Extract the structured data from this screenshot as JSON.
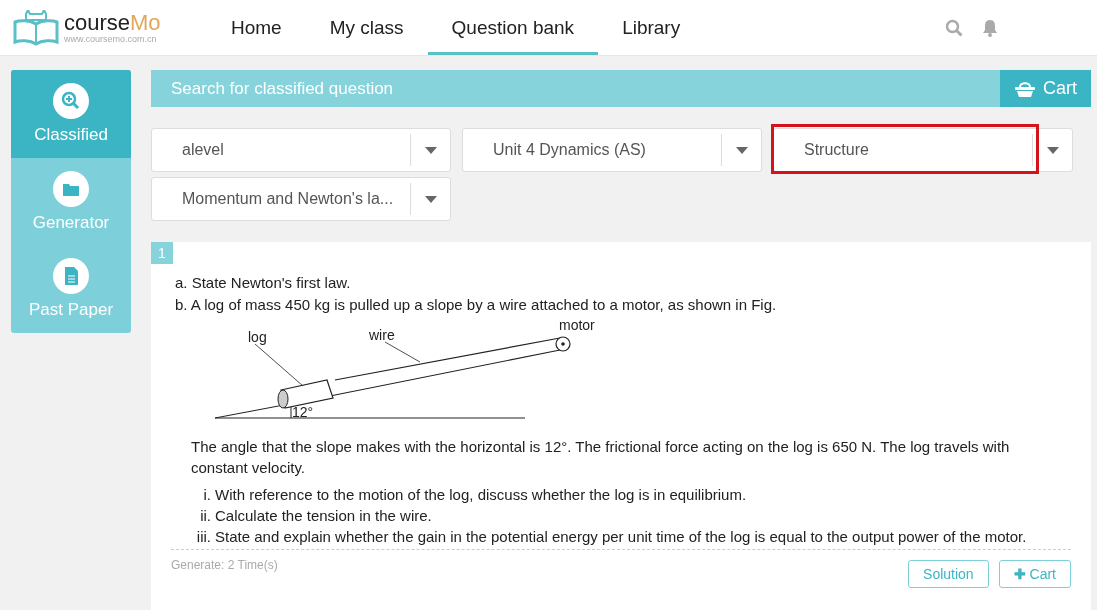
{
  "logo": {
    "name": "course",
    "name_accent": "Mo",
    "url": "www.coursemo.com.cn"
  },
  "nav": [
    {
      "label": "Home",
      "selected": false
    },
    {
      "label": "My class",
      "selected": false
    },
    {
      "label": "Question bank",
      "selected": true
    },
    {
      "label": "Library",
      "selected": false
    }
  ],
  "sidebar": {
    "items": [
      {
        "label": "Classified",
        "selected": true,
        "kind": "search"
      },
      {
        "label": "Generator",
        "selected": false,
        "kind": "folder"
      },
      {
        "label": "Past Paper",
        "selected": false,
        "kind": "document"
      }
    ]
  },
  "search_bar": {
    "title": "Search for classified question",
    "cart_label": "Cart"
  },
  "filters": [
    {
      "value": "alevel",
      "highlighted": false
    },
    {
      "value": "Unit 4 Dynamics (AS)",
      "highlighted": false
    },
    {
      "value": "Structure",
      "highlighted": true
    },
    {
      "value": "Momentum and Newton's la...",
      "highlighted": false
    }
  ],
  "question": {
    "number": "1",
    "parts": [
      "a. State Newton's first law.",
      "b. A log of mass 450 kg is pulled up a slope by a wire attached to a motor, as shown in Fig."
    ],
    "figure_labels": {
      "log": "log",
      "wire": "wire",
      "motor": "motor",
      "angle": "12°"
    },
    "paragraph": "The angle that the slope makes with the horizontal is 12°. The frictional force acting on the log is 650 N. The log travels with constant velocity.",
    "subparts": [
      {
        "numeral": "i.",
        "text": "With reference to the motion of the log, discuss whether the log is in equilibrium."
      },
      {
        "numeral": "ii.",
        "text": "Calculate the tension in the wire."
      },
      {
        "numeral": "iii.",
        "text": "State and explain whether the gain in the potential energy per unit time of the log is equal to the output power of the motor."
      }
    ],
    "generate_count": "Generate: 2 Time(s)",
    "solution_label": "Solution",
    "cart_icon_text": "✚",
    "cart_label": "Cart"
  }
}
